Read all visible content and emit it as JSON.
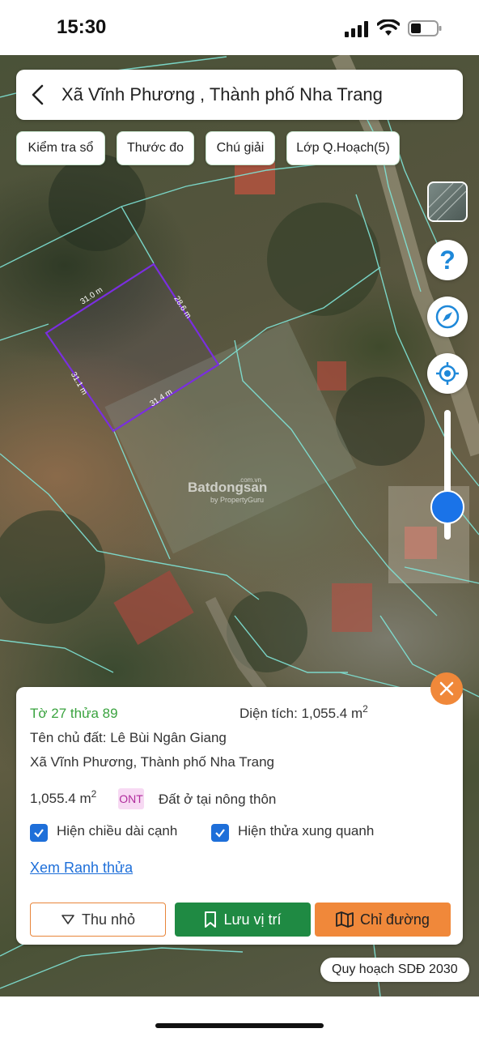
{
  "status_bar": {
    "time": "15:30"
  },
  "header": {
    "title": "Xã Vĩnh Phương , Thành phố Nha Trang"
  },
  "chips": [
    {
      "label": "Kiểm tra sổ"
    },
    {
      "label": "Thước đo"
    },
    {
      "label": "Chú giải"
    },
    {
      "label": "Lớp Q.Hoạch(5)"
    }
  ],
  "map": {
    "edge_labels": [
      "31.0 m",
      "28.6 m",
      "31.4 m",
      "31.1 m"
    ],
    "parcel_color": "#7a2ee0",
    "boundary_color": "#7fe3d6",
    "watermark": {
      "brand": "Batdongsan",
      "sub": "by PropertyGuru",
      "domain": ".com.vn"
    }
  },
  "controls": {
    "help_icon": "question-icon",
    "compass_icon": "compass-icon",
    "locate_icon": "locate-icon",
    "zoom_level": 0.75
  },
  "card": {
    "parcel_ref": "Tờ 27 thửa 89",
    "area_label": "Diện tích: 1,055.4 m",
    "area_sup": "2",
    "owner": "Tên chủ đất: Lê Bùi Ngân Giang",
    "address": "Xã Vĩnh Phương, Thành phố Nha Trang",
    "land_area": "1,055.4 m",
    "land_area_sup": "2",
    "land_code": "ONT",
    "land_type": "Đất ở tại nông thôn",
    "checkbox_edges": "Hiện chiều dài cạnh",
    "checkbox_neighbors": "Hiện thửa xung quanh",
    "link": "Xem Ranh thửa",
    "btn_minimize": "Thu nhỏ",
    "btn_save": "Lưu vị trí",
    "btn_route": "Chỉ đường"
  },
  "plan_pill": "Quy hoạch SDĐ 2030",
  "colors": {
    "accent_green": "#1f8a43",
    "accent_orange": "#f0883a",
    "link_blue": "#1e6fd9",
    "parcel_ref_green": "#3aa33f"
  }
}
